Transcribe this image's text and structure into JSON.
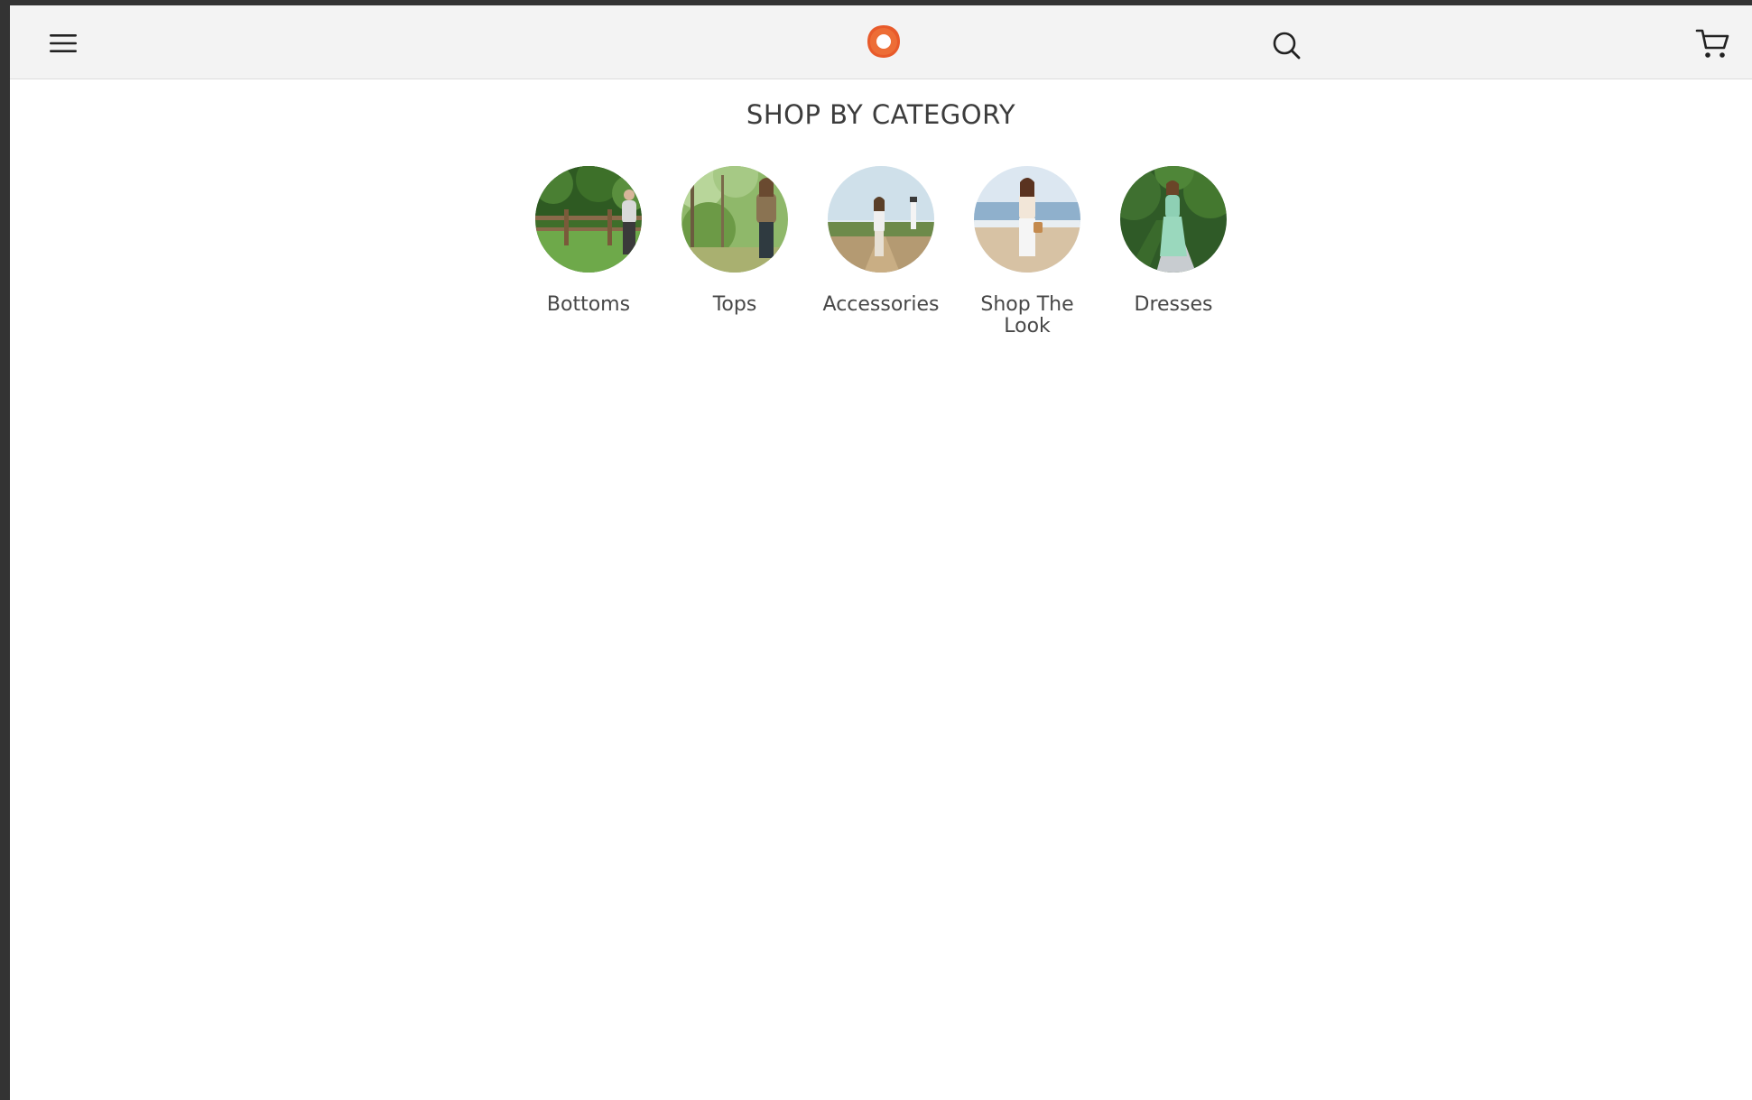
{
  "header": {
    "menu_icon": "hamburger-menu-icon",
    "logo_icon": "brand-logo-icon",
    "search_icon": "search-icon",
    "cart_icon": "cart-icon",
    "accent_color": "#e85a2a"
  },
  "section": {
    "title": "SHOP BY CATEGORY"
  },
  "categories": [
    {
      "label": "Bottoms"
    },
    {
      "label": "Tops"
    },
    {
      "label": "Accessories"
    },
    {
      "label": "Shop The Look"
    },
    {
      "label": "Dresses"
    }
  ]
}
